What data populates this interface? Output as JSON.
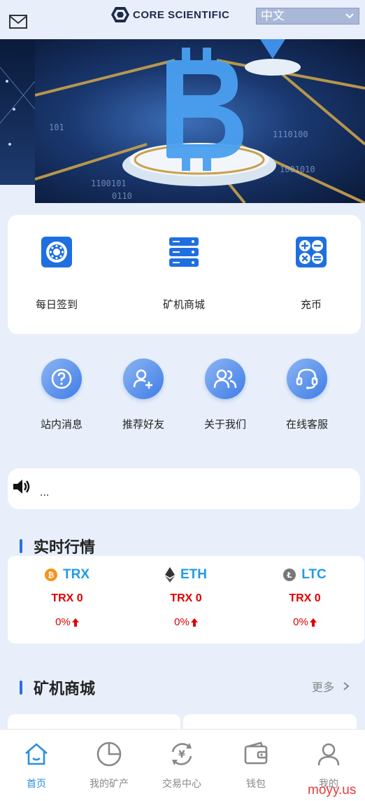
{
  "header": {
    "logo_text": "CORE SCIENTIFIC",
    "language": "中文"
  },
  "quick_actions": [
    {
      "label": "每日签到",
      "icon": "checkin-icon"
    },
    {
      "label": "矿机商城",
      "icon": "server-icon"
    },
    {
      "label": "充币",
      "icon": "calculator-icon"
    }
  ],
  "shortcuts": [
    {
      "label": "站内消息",
      "icon": "question-icon"
    },
    {
      "label": "推荐好友",
      "icon": "add-user-icon"
    },
    {
      "label": "关于我们",
      "icon": "users-icon"
    },
    {
      "label": "在线客服",
      "icon": "headset-icon"
    }
  ],
  "notice": {
    "text": "..."
  },
  "market": {
    "title": "实时行情",
    "coins": [
      {
        "name": "TRX",
        "price": "TRX 0",
        "change": "0%"
      },
      {
        "name": "ETH",
        "price": "TRX 0",
        "change": "0%"
      },
      {
        "name": "LTC",
        "price": "TRX 0",
        "change": "0%"
      }
    ]
  },
  "shop": {
    "title": "矿机商城",
    "more": "更多"
  },
  "tabbar": [
    {
      "label": "首页",
      "icon": "home-icon",
      "active": true
    },
    {
      "label": "我的矿产",
      "icon": "pie-chart-icon",
      "active": false
    },
    {
      "label": "交易中心",
      "icon": "exchange-icon",
      "active": false
    },
    {
      "label": "钱包",
      "icon": "wallet-icon",
      "active": false
    },
    {
      "label": "我的",
      "icon": "user-icon",
      "active": false
    }
  ],
  "watermark": "moyy.us",
  "colors": {
    "accent": "#2b6fe0",
    "price": "#e00000",
    "coin_name": "#1e9be8",
    "page_bg": "#e8effb"
  }
}
